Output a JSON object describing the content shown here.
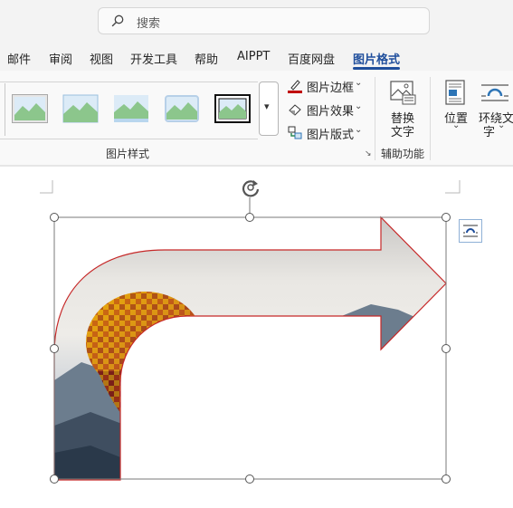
{
  "search": {
    "placeholder": "搜索"
  },
  "tabs": [
    {
      "label": "邮件"
    },
    {
      "label": "审阅"
    },
    {
      "label": "视图"
    },
    {
      "label": "开发工具"
    },
    {
      "label": "帮助"
    },
    {
      "label": "AIPPT"
    },
    {
      "label": "百度网盘"
    },
    {
      "label": "图片格式",
      "active": true
    }
  ],
  "ribbon": {
    "picture_styles": {
      "group_label": "图片样式",
      "border_label": "图片边框",
      "effects_label": "图片效果",
      "layout_label": "图片版式"
    },
    "accessibility": {
      "group_label": "辅助功能",
      "alt_text_line1": "替换",
      "alt_text_line2": "文字"
    },
    "arrange": {
      "position_label": "位置",
      "wrap_text_line1": "环绕文",
      "wrap_text_line2": "字"
    }
  },
  "colors": {
    "accent": "#1f4e9c",
    "border_swatch": "#c00000",
    "shape_outline": "#c62828"
  }
}
